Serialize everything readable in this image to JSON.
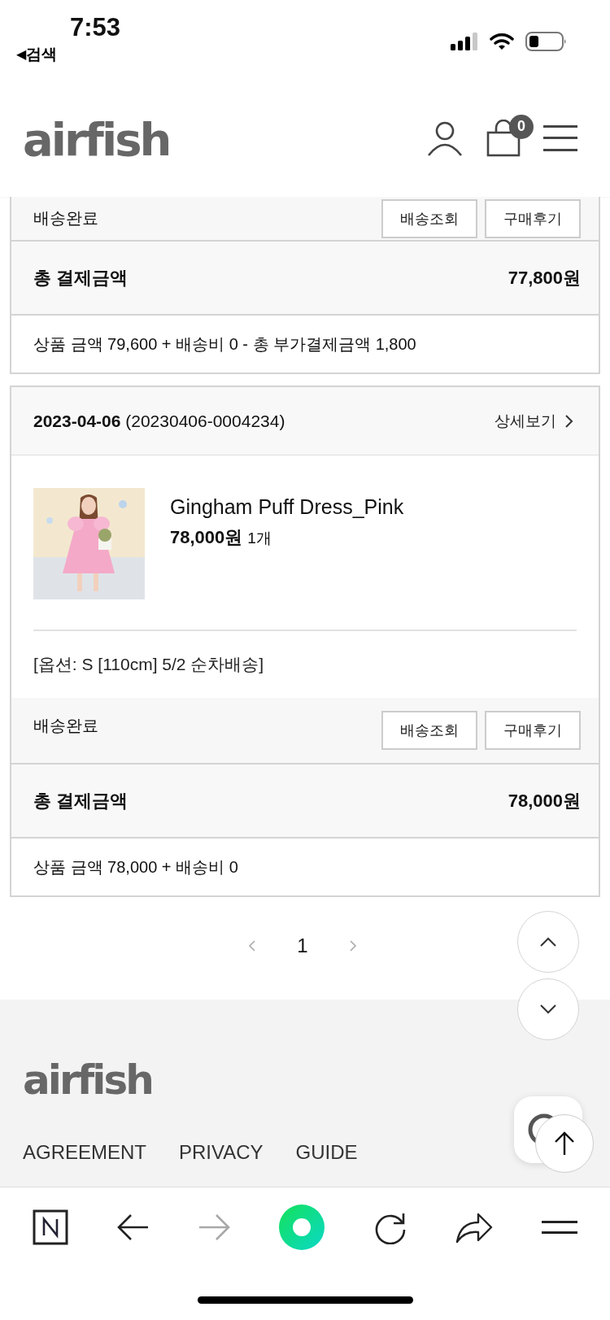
{
  "status_bar": {
    "time": "7:53",
    "back_arrow": "◀",
    "back_label": "검색"
  },
  "header": {
    "logo": "airfish",
    "cart_count": "0"
  },
  "orders": [
    {
      "status": "배송완료",
      "buttons": [
        "배송조회",
        "구매후기"
      ],
      "total_label": "총 결제금액",
      "total": "77,800원",
      "summary": "상품 금액 79,600 + 배송비 0 - 총 부가결제금액 1,800"
    },
    {
      "date": "2023-04-06",
      "order_no": "(20230406-0004234)",
      "detail_link": "상세보기",
      "product": {
        "name": "Gingham Puff Dress_Pink",
        "price": "78,000원",
        "qty": "1개"
      },
      "option": "[옵션: S [110cm] 5/2 순차배송]",
      "status": "배송완료",
      "buttons": [
        "배송조회",
        "구매후기"
      ],
      "total_label": "총 결제금액",
      "total": "78,000원",
      "summary": "상품 금액 78,000 + 배송비 0"
    }
  ],
  "pagination": {
    "pages": [
      {
        "label": "1",
        "selected": true
      }
    ]
  },
  "footer": {
    "logo": "airfish",
    "links": [
      "AGREEMENT",
      "PRIVACY",
      "GUIDE"
    ]
  },
  "browser_toolbar": {
    "forward_disabled": true
  }
}
